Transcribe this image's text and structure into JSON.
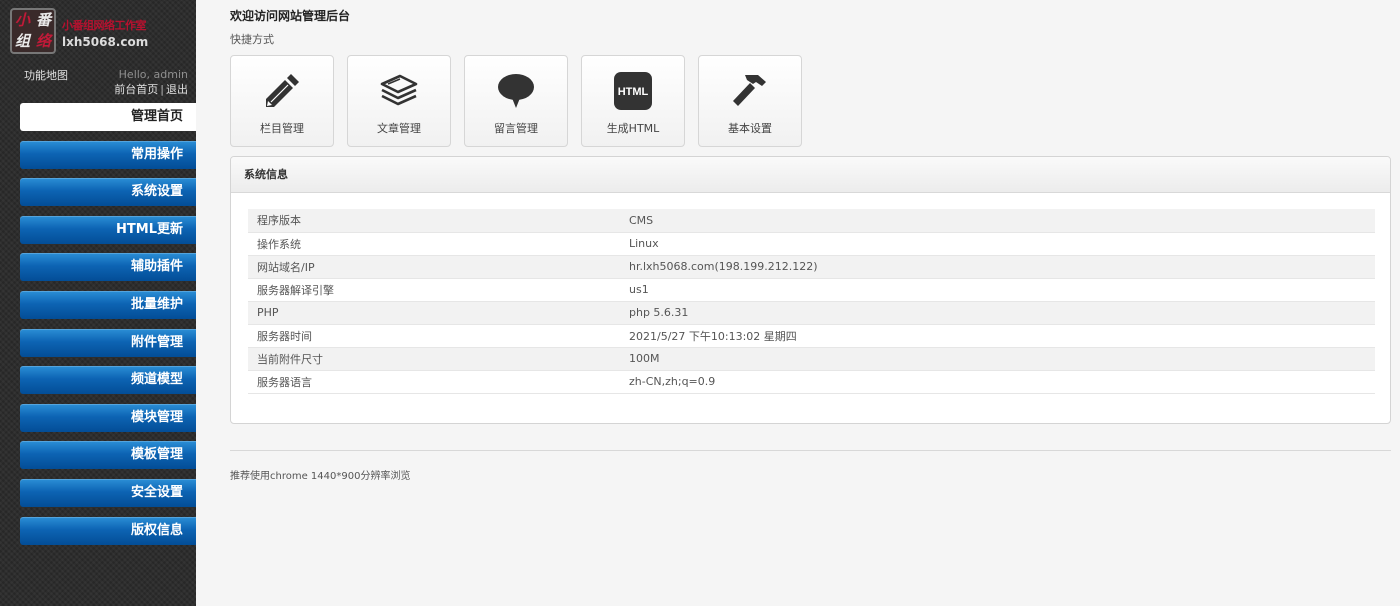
{
  "brand": {
    "logo_chars": [
      "小",
      "番",
      "组",
      "络"
    ],
    "name": "小番组网络工作室",
    "domain": "lxh5068.com"
  },
  "user": {
    "sitemap_label": "功能地图",
    "greeting": "Hello, admin",
    "front_link": "前台首页",
    "separator": "|",
    "logout_link": "退出"
  },
  "menu": [
    {
      "label": "管理首页",
      "active": true
    },
    {
      "label": "常用操作"
    },
    {
      "label": "系统设置"
    },
    {
      "label": "HTML更新"
    },
    {
      "label": "辅助插件"
    },
    {
      "label": "批量维护"
    },
    {
      "label": "附件管理"
    },
    {
      "label": "频道模型"
    },
    {
      "label": "模块管理"
    },
    {
      "label": "模板管理"
    },
    {
      "label": "安全设置"
    },
    {
      "label": "版权信息"
    }
  ],
  "main": {
    "welcome": "欢迎访问网站管理后台",
    "shortcut_title": "快捷方式",
    "shortcuts": [
      {
        "label": "栏目管理",
        "icon": "pencil-icon"
      },
      {
        "label": "文章管理",
        "icon": "stack-icon"
      },
      {
        "label": "留言管理",
        "icon": "speech-bubble-icon"
      },
      {
        "label": "生成HTML",
        "icon": "html-icon",
        "icon_text": "HTML"
      },
      {
        "label": "基本设置",
        "icon": "hammer-icon"
      }
    ],
    "sysinfo": {
      "title": "系统信息",
      "rows": [
        {
          "key": "程序版本",
          "value": "CMS"
        },
        {
          "key": "操作系统",
          "value": "Linux"
        },
        {
          "key": "网站域名/IP",
          "value": "hr.lxh5068.com(198.199.212.122)"
        },
        {
          "key": "服务器解译引擎",
          "value": "us1"
        },
        {
          "key": "PHP",
          "value": "php 5.6.31"
        },
        {
          "key": "服务器时间",
          "value": "2021/5/27 下午10:13:02 星期四"
        },
        {
          "key": "当前附件尺寸",
          "value": "100M"
        },
        {
          "key": "服务器语言",
          "value": "zh-CN,zh;q=0.9"
        }
      ]
    },
    "footer_note": "推荐使用chrome 1440*900分辨率浏览"
  },
  "colors": {
    "menu_blue": "#0d64b4",
    "brand_red": "#b6112f",
    "sidebar_bg": "#2b2b2b"
  }
}
